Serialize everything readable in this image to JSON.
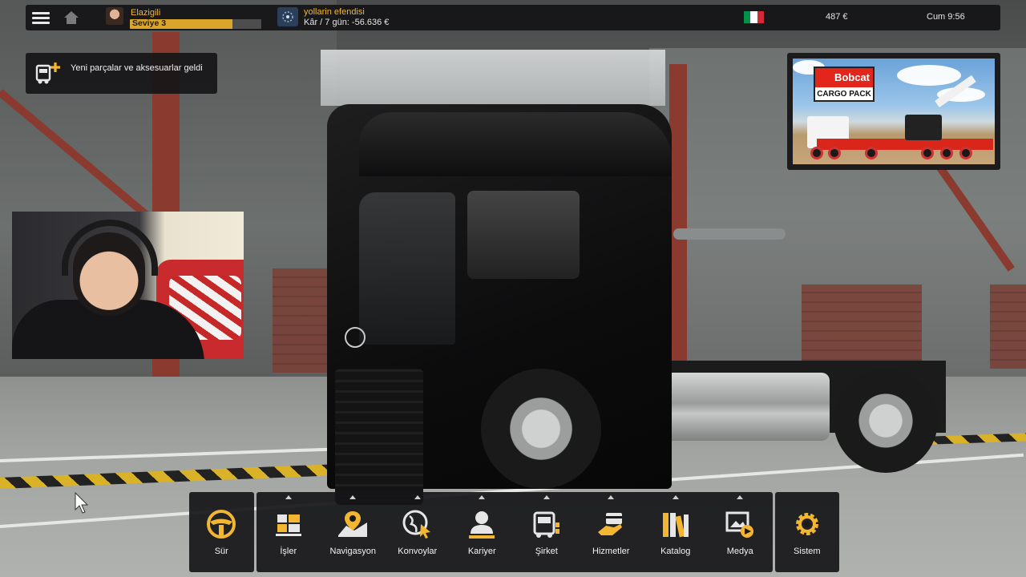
{
  "topbar": {
    "profile": {
      "name": "Elazigili",
      "level_label": "Seviye 3",
      "level_progress_pct": 78
    },
    "company": {
      "name": "yollarin efendisi",
      "profit": "Kâr / 7 gün: -56.636 €",
      "logo": "europe-map-icon"
    },
    "country_flag": {
      "country": "Italy",
      "colors": [
        "#009246",
        "#ffffff",
        "#ce2b37"
      ]
    },
    "money": "487 €",
    "clock": "Cum 9:56"
  },
  "notification": {
    "text": "Yeni parçalar ve aksesuarlar geldi",
    "icon": "truck-plus-icon"
  },
  "ad": {
    "brand": "Bobcat",
    "pack": "CARGO PACK"
  },
  "menu": {
    "items": [
      {
        "label": "Sür",
        "icon": "steering-wheel-icon"
      },
      {
        "label": "İşler",
        "icon": "cargo-boxes-icon"
      },
      {
        "label": "Navigasyon",
        "icon": "map-pin-icon"
      },
      {
        "label": "Konvoylar",
        "icon": "convoy-globe-icon"
      },
      {
        "label": "Kariyer",
        "icon": "person-icon"
      },
      {
        "label": "Şirket",
        "icon": "company-truck-icon"
      },
      {
        "label": "Hizmetler",
        "icon": "service-hand-icon"
      },
      {
        "label": "Katalog",
        "icon": "catalog-books-icon"
      },
      {
        "label": "Medya",
        "icon": "media-image-icon"
      },
      {
        "label": "Sistem",
        "icon": "gear-icon"
      }
    ]
  },
  "colors": {
    "accent": "#f2b632",
    "panel": "#161618",
    "level_fill": "#d9a52b"
  }
}
